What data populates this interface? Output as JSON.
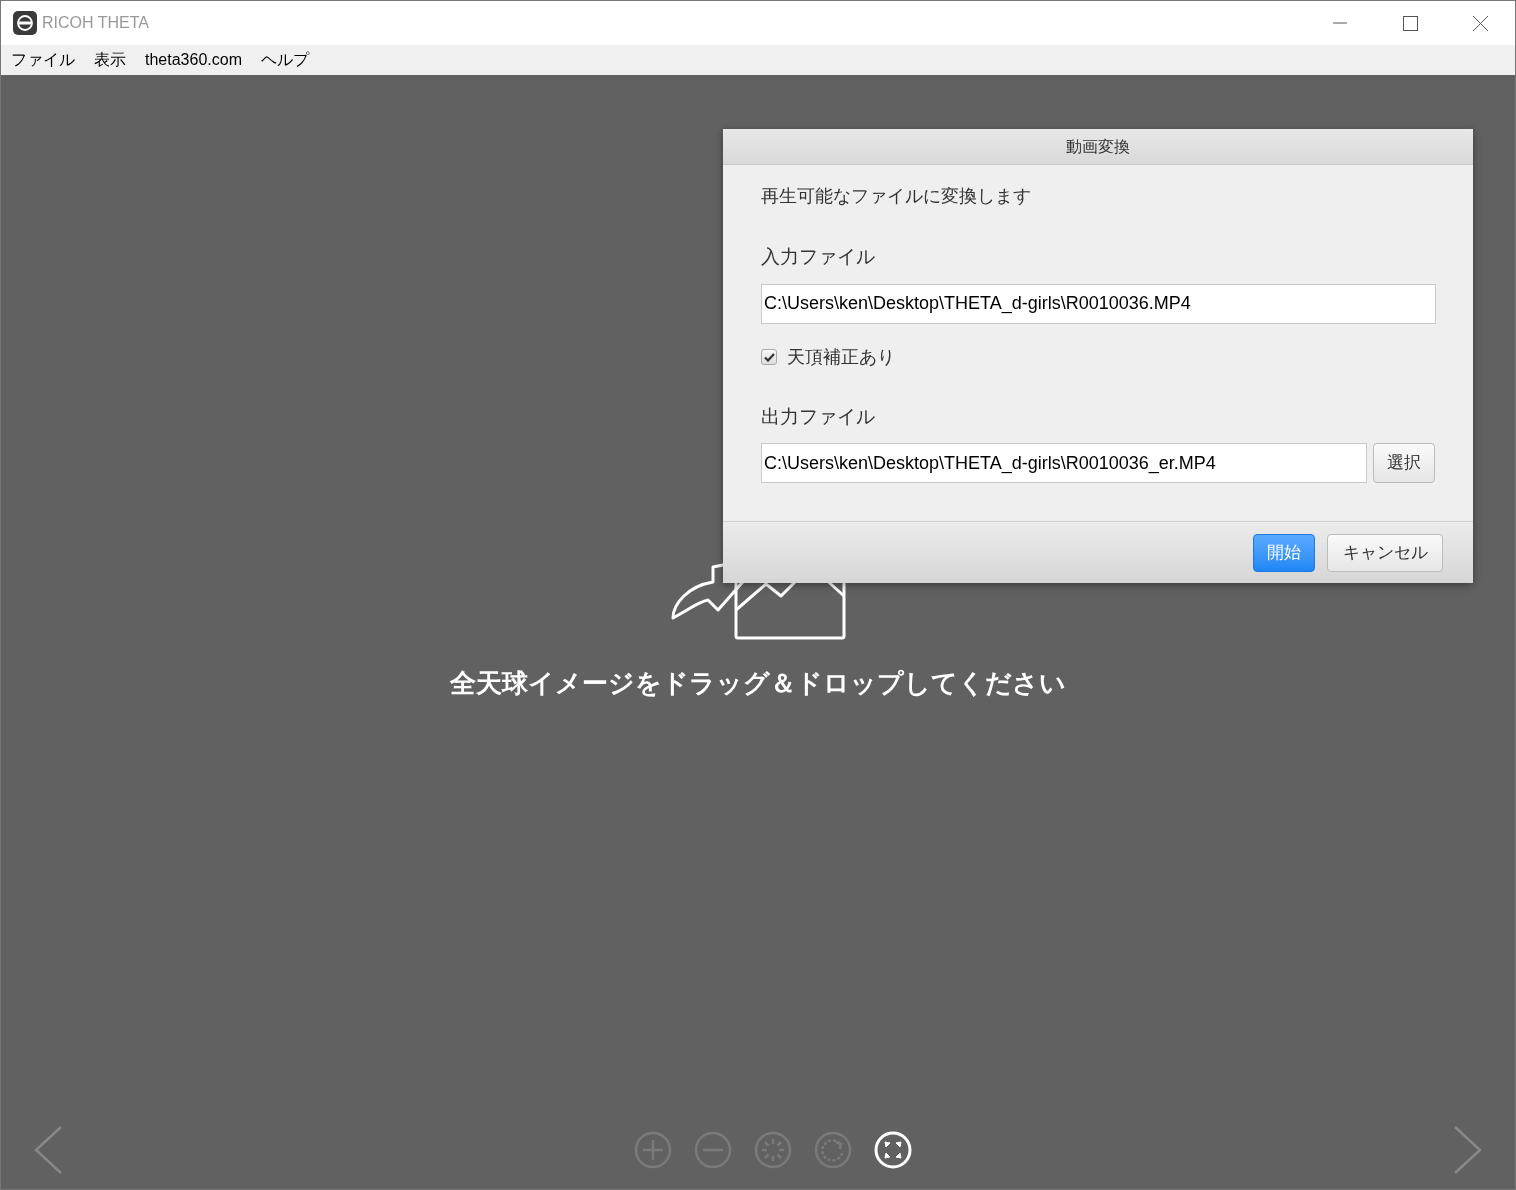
{
  "window": {
    "title": "RICOH THETA"
  },
  "menu": [
    "ファイル",
    "表示",
    "theta360.com",
    "ヘルプ"
  ],
  "drop_hint": {
    "text": "全天球イメージをドラッグ＆ドロップしてください"
  },
  "toolbar": [
    {
      "kind": "zoom-in",
      "disabled": true
    },
    {
      "kind": "zoom-out",
      "disabled": true
    },
    {
      "kind": "loading",
      "disabled": true
    },
    {
      "kind": "rotate",
      "disabled": true
    },
    {
      "kind": "fullscreen",
      "disabled": false
    }
  ],
  "dialog": {
    "title": "動画変換",
    "description": "再生可能なファイルに変換します",
    "input_label": "入力ファイル",
    "input_value": "C:\\Users\\ken\\Desktop\\THETA_d-girls\\R0010036.MP4",
    "zenith": {
      "label": "天頂補正あり",
      "checked": true
    },
    "output_label": "出力ファイル",
    "output_value": "C:\\Users\\ken\\Desktop\\THETA_d-girls\\R0010036_er.MP4",
    "select_button": "選択",
    "start_button": "開始",
    "cancel_button": "キャンセル"
  }
}
